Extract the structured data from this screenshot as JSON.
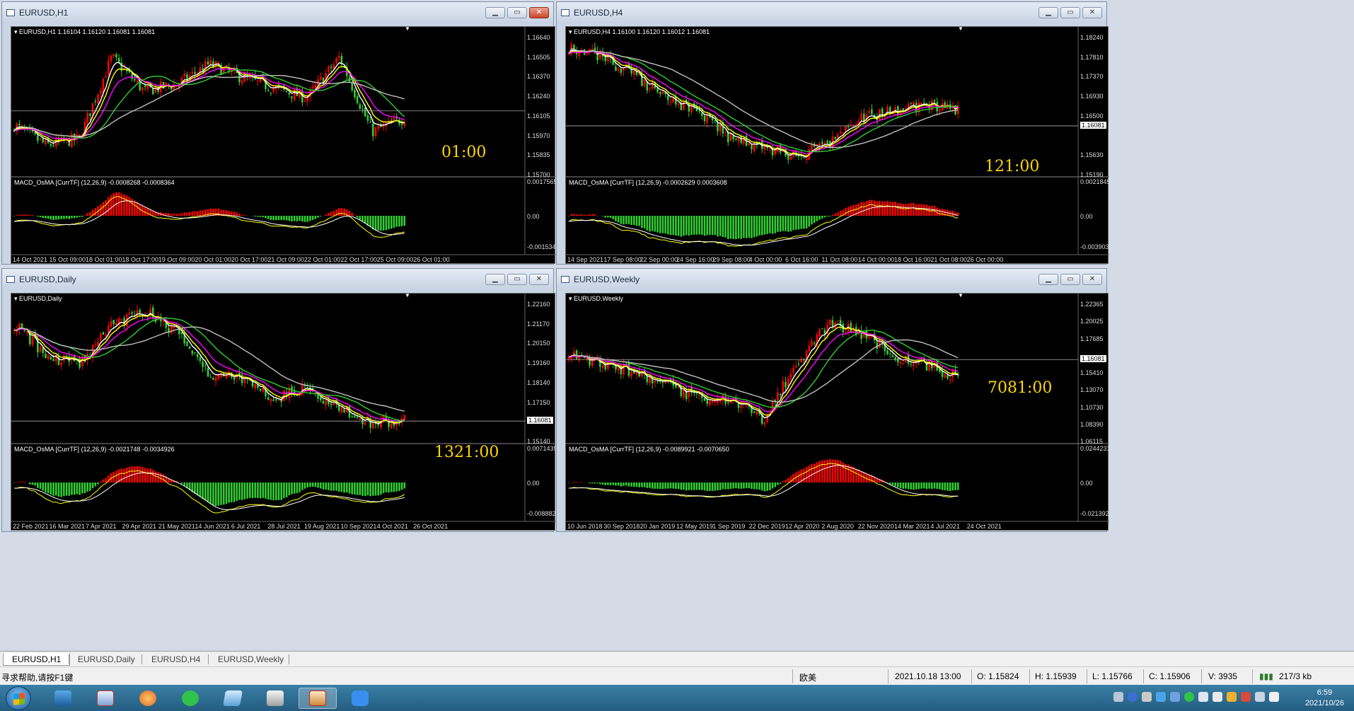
{
  "windows": [
    {
      "id": "h1",
      "title": "EURUSD,H1",
      "header": "EURUSD,H1  1.16104 1.16120 1.16081 1.16081",
      "macd_header": "MACD_OsMA [CurrTF] (12,26,9) -0.0008268 -0.0008364",
      "timer": "01:00",
      "price_labels": [
        "1.16640",
        "1.16505",
        "1.16370",
        "1.16240",
        "1.16105",
        "1.15970",
        "1.15835",
        "1.15700"
      ],
      "current_price": "1.16081",
      "macd_labels": [
        "0.0017565",
        "0.00",
        "-0.001534"
      ],
      "date_labels": [
        "14 Oct 2021",
        "15 Oct 09:00",
        "18 Oct 01:00",
        "18 Oct 17:00",
        "19 Oct 09:00",
        "20 Oct 01:00",
        "20 Oct 17:00",
        "21 Oct 09:00",
        "22 Oct 01:00",
        "22 Oct 17:00",
        "25 Oct 09:00",
        "26 Oct 01:00"
      ],
      "active": true
    },
    {
      "id": "h4",
      "title": "EURUSD,H4",
      "header": "EURUSD,H4  1.16100 1.16120 1.16012 1.16081",
      "macd_header": "MACD_OsMA [CurrTF] (12,26,9) -0.0002629 0.0003608",
      "timer": "121:00",
      "price_labels": [
        "1.18240",
        "1.17810",
        "1.17370",
        "1.16930",
        "1.16500",
        "1.16081",
        "1.15630",
        "1.15190"
      ],
      "current_price": "1.16081",
      "macd_labels": [
        "0.0021845",
        "0.00",
        "-0.003903"
      ],
      "date_labels": [
        "14 Sep 2021",
        "17 Sep 08:00",
        "22 Sep 00:00",
        "24 Sep 16:00",
        "29 Sep 08:00",
        "4 Oct 00:00",
        "6 Oct 16:00",
        "11 Oct 08:00",
        "14 Oct 00:00",
        "18 Oct 16:00",
        "21 Oct 08:00",
        "26 Oct 00:00"
      ],
      "active": false
    },
    {
      "id": "d1",
      "title": "EURUSD,Daily",
      "header": "EURUSD,Daily",
      "macd_header": "MACD_OsMA [CurrTF] (12,26,9) -0.0021748 -0.0034926",
      "timer": "1321:00",
      "price_labels": [
        "1.22160",
        "1.21170",
        "1.20150",
        "1.19160",
        "1.18140",
        "1.17150",
        "1.16081",
        "1.15140"
      ],
      "current_price": "1.16081",
      "macd_labels": [
        "0.0071439",
        "0.00",
        "-0.008882"
      ],
      "date_labels": [
        "22 Feb 2021",
        "16 Mar 2021",
        "7 Apr 2021",
        "29 Apr 2021",
        "21 May 2021",
        "14 Jun 2021",
        "6 Jul 2021",
        "28 Jul 2021",
        "19 Aug 2021",
        "10 Sep 2021",
        "4 Oct 2021",
        "26 Oct 2021"
      ],
      "active": false
    },
    {
      "id": "w1",
      "title": "EURUSD,Weekly",
      "header": "EURUSD,Weekly",
      "macd_header": "MACD_OsMA [CurrTF] (12,26,9) -0.0089921 -0.0070650",
      "timer": "7081:00",
      "price_labels": [
        "1.22365",
        "1.20025",
        "1.17685",
        "1.16081",
        "1.15410",
        "1.13070",
        "1.10730",
        "1.08390",
        "1.06115"
      ],
      "current_price": "1.16081",
      "macd_labels": [
        "0.0244231",
        "0.00",
        "-0.021392"
      ],
      "date_labels": [
        "10 Jun 2018",
        "30 Sep 2018",
        "20 Jan 2019",
        "12 May 2019",
        "1 Sep 2019",
        "22 Dec 2019",
        "12 Apr 2020",
        "2 Aug 2020",
        "22 Nov 2020",
        "14 Mar 2021",
        "4 Jul 2021",
        "24 Oct 2021"
      ],
      "active": false
    }
  ],
  "tabs": [
    "EURUSD,H1",
    "EURUSD,Daily",
    "EURUSD,H4",
    "EURUSD,Weekly"
  ],
  "status": {
    "help": "寻求帮助,请按F1键",
    "profile": "欧美",
    "datetime": "2021.10.18 13:00",
    "open": "O: 1.15824",
    "high": "H: 1.15939",
    "low": "L: 1.15766",
    "close": "C: 1.15906",
    "volume": "V: 3935",
    "traffic": "217/3 kb"
  },
  "taskbar": {
    "apps": [
      "explorer-icon",
      "mt4-icon",
      "browser-icon",
      "wechat-icon",
      "notepad-icon",
      "tools-icon",
      "mt4-active-icon",
      "feishu-icon"
    ],
    "clock_time": "6:59",
    "clock_date": "2021/10/26"
  },
  "colors": {
    "bull": "#ff0000",
    "bear": "#32cd32",
    "ma_fast": "#ffffff",
    "ma_yellow": "#ffff00",
    "ma_magenta": "#ff00ff",
    "ma_green": "#32cd32",
    "ma_slow": "#c0c0c0",
    "timer": "#ffd700"
  }
}
